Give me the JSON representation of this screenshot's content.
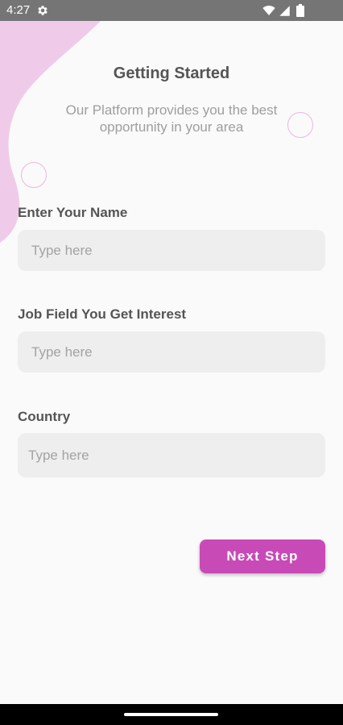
{
  "status_bar": {
    "time": "4:27",
    "icons": [
      "gear-icon",
      "wifi-icon",
      "signal-icon",
      "battery-icon"
    ]
  },
  "header": {
    "title": "Getting Started",
    "subtitle": "Our Platform provides you the best opportunity in your area"
  },
  "form": {
    "fields": [
      {
        "label": "Enter Your Name",
        "placeholder": "Type here",
        "value": ""
      },
      {
        "label": "Job Field You Get Interest",
        "placeholder": "Type here",
        "value": ""
      },
      {
        "label": "Country",
        "placeholder": "Type here",
        "value": ""
      }
    ],
    "next_label": "Next Step"
  },
  "colors": {
    "accent": "#c84ab7",
    "blob": "#f0cbe9",
    "status_bar": "#757575",
    "input_bg": "#eeeeee"
  }
}
